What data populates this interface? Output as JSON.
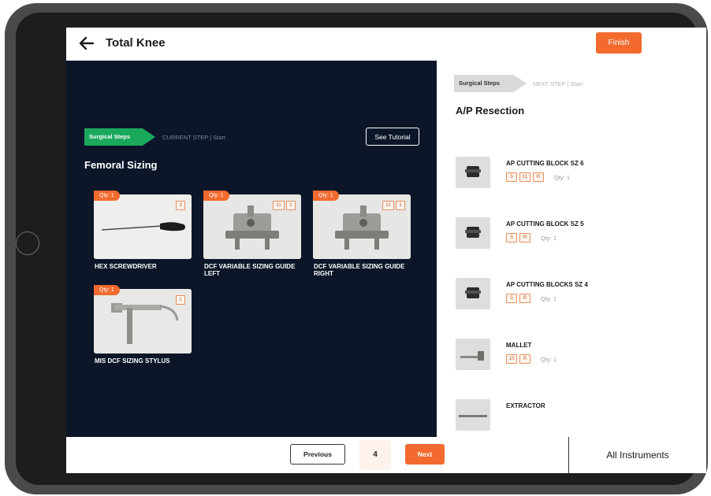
{
  "header": {
    "title": "Total Knee",
    "finish_label": "Finish"
  },
  "current": {
    "step_pill": "Surgical Steps",
    "step_text": "CURRENT STEP | Start",
    "tutorial_label": "See Tutorial",
    "title": "Femoral Sizing",
    "instruments": [
      {
        "name": "HEX SCREWDRIVER",
        "qty": "Qty: 1",
        "counts": [
          "3"
        ],
        "icon": "screwdriver"
      },
      {
        "name": "DCF VARIABLE SIZING GUIDE LEFT",
        "qty": "Qty: 1",
        "counts": [
          "11",
          "1"
        ],
        "icon": "sizing-guide"
      },
      {
        "name": "DCF VARIABLE SIZING GUIDE RIGHT",
        "qty": "Qty: 1",
        "counts": [
          "11",
          "1"
        ],
        "icon": "sizing-guide"
      },
      {
        "name": "MIS DCF SIZING STYLUS",
        "qty": "Qty: 1",
        "counts": [
          "1"
        ],
        "icon": "stylus"
      }
    ]
  },
  "next": {
    "step_pill": "Surgical Steps",
    "step_text": "NEXT STEP | Start",
    "title": "A/P Resection",
    "items": [
      {
        "name": "AP CUTTING BLOCK SZ 6",
        "boxes": [
          "5",
          "11",
          "R"
        ],
        "qty": "Qty: 1",
        "icon": "cutting-block"
      },
      {
        "name": "AP CUTTING BLOCK SZ 5",
        "boxes": [
          "5",
          "R"
        ],
        "qty": "Qty: 1",
        "icon": "cutting-block"
      },
      {
        "name": "AP CUTTING BLOCKS SZ 4",
        "boxes": [
          "5",
          "R"
        ],
        "qty": "Qty: 1",
        "icon": "cutting-block"
      },
      {
        "name": "MALLET",
        "boxes": [
          "10",
          "R"
        ],
        "qty": "Qty: 1",
        "icon": "mallet"
      },
      {
        "name": "EXTRACTOR",
        "boxes": [],
        "qty": "",
        "icon": "extractor"
      }
    ]
  },
  "footer": {
    "previous_label": "Previous",
    "page": "4",
    "next_label": "Next",
    "all_instruments_label": "All Instruments"
  },
  "colors": {
    "accent": "#f26a2e",
    "current_step": "#1aa85d",
    "panel_dark": "#0c1628",
    "next_step": "#d9d9d9"
  }
}
